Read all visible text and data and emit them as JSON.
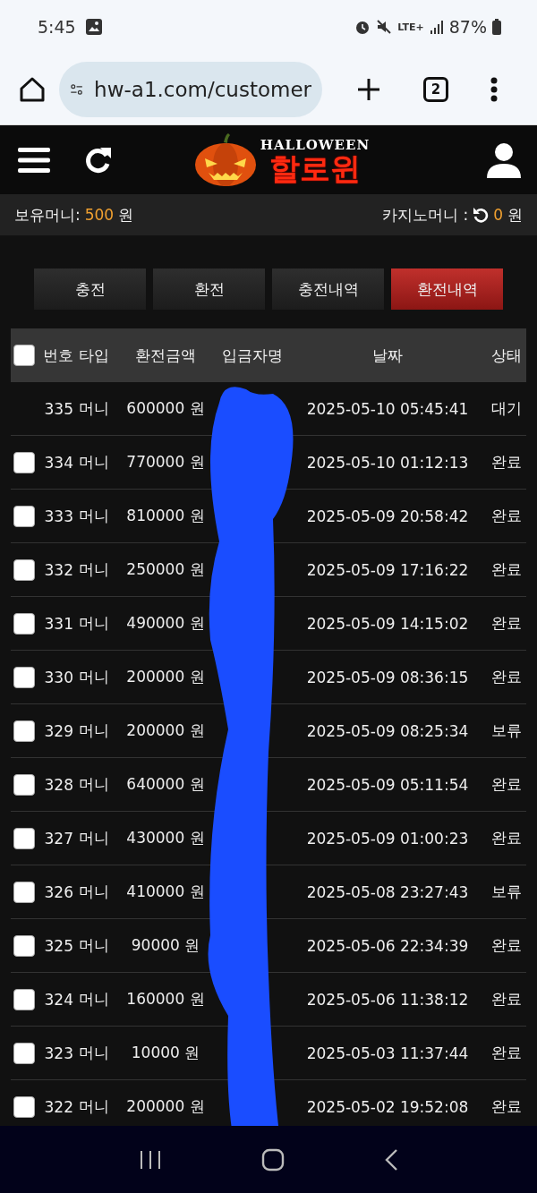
{
  "status_bar": {
    "time": "5:45",
    "network": "LTE+",
    "battery": "87%"
  },
  "browser": {
    "url": "hw-a1.com/customer",
    "tab_count": "2"
  },
  "logo": {
    "tagline": "HALLOWEEN",
    "name": "할로윈"
  },
  "balance": {
    "label": "보유머니:",
    "amount": "500",
    "unit": "원",
    "casino_label": "카지노머니 :",
    "casino_amount": "0",
    "casino_unit": "원"
  },
  "tabs": [
    {
      "label": "충전",
      "selected": false
    },
    {
      "label": "환전",
      "selected": false
    },
    {
      "label": "충전내역",
      "selected": false
    },
    {
      "label": "환전내역",
      "selected": true
    }
  ],
  "table": {
    "select_all": {
      "checked": false
    },
    "columns": [
      "번호",
      "타입",
      "환전금액",
      "입금자명",
      "날짜",
      "상태"
    ],
    "rows": [
      {
        "number": "335",
        "type": "머니",
        "amount": "600000 원",
        "date": "2025-05-10 05:45:41",
        "status": "대기",
        "selectable": false
      },
      {
        "number": "334",
        "type": "머니",
        "amount": "770000 원",
        "date": "2025-05-10 01:12:13",
        "status": "완료",
        "selectable": true,
        "checked": false
      },
      {
        "number": "333",
        "type": "머니",
        "amount": "810000 원",
        "date": "2025-05-09 20:58:42",
        "status": "완료",
        "selectable": true,
        "checked": false
      },
      {
        "number": "332",
        "type": "머니",
        "amount": "250000 원",
        "date": "2025-05-09 17:16:22",
        "status": "완료",
        "selectable": true,
        "checked": false
      },
      {
        "number": "331",
        "type": "머니",
        "amount": "490000 원",
        "date": "2025-05-09 14:15:02",
        "status": "완료",
        "selectable": true,
        "checked": false
      },
      {
        "number": "330",
        "type": "머니",
        "amount": "200000 원",
        "date": "2025-05-09 08:36:15",
        "status": "완료",
        "selectable": true,
        "checked": false
      },
      {
        "number": "329",
        "type": "머니",
        "amount": "200000 원",
        "date": "2025-05-09 08:25:34",
        "status": "보류",
        "selectable": true,
        "checked": false
      },
      {
        "number": "328",
        "type": "머니",
        "amount": "640000 원",
        "date": "2025-05-09 05:11:54",
        "status": "완료",
        "selectable": true,
        "checked": false
      },
      {
        "number": "327",
        "type": "머니",
        "amount": "430000 원",
        "date": "2025-05-09 01:00:23",
        "status": "완료",
        "selectable": true,
        "checked": false
      },
      {
        "number": "326",
        "type": "머니",
        "amount": "410000 원",
        "date": "2025-05-08 23:27:43",
        "status": "보류",
        "selectable": true,
        "checked": false
      },
      {
        "number": "325",
        "type": "머니",
        "amount": "90000 원",
        "date": "2025-05-06 22:34:39",
        "status": "완료",
        "selectable": true,
        "checked": false
      },
      {
        "number": "324",
        "type": "머니",
        "amount": "160000 원",
        "date": "2025-05-06 11:38:12",
        "status": "완료",
        "selectable": true,
        "checked": false
      },
      {
        "number": "323",
        "type": "머니",
        "amount": "10000 원",
        "date": "2025-05-03 11:37:44",
        "status": "완료",
        "selectable": true,
        "checked": false
      },
      {
        "number": "322",
        "type": "머니",
        "amount": "200000 원",
        "date": "2025-05-02 19:52:08",
        "status": "완료",
        "selectable": true,
        "checked": false
      }
    ]
  }
}
